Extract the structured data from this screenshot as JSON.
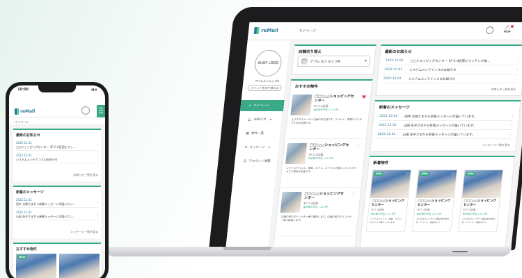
{
  "brand": {
    "app_name": "reMall",
    "accent": "#3aa987",
    "brand_blue": "#2a7a99"
  },
  "laptop": {
    "topbar": {
      "breadcrumb": "マイページ"
    },
    "sidebar": {
      "shop_logo": "SHOP LOGO",
      "shop_name": "アパレルショップA",
      "switch_button": "テナントを切り替える",
      "items": [
        {
          "label": "マイページ",
          "icon": "home-icon",
          "active": true
        },
        {
          "label": "お知らせ",
          "icon": "bell-icon",
          "badge": true
        },
        {
          "label": "物件一覧",
          "icon": "building-icon"
        },
        {
          "label": "メッセージ",
          "icon": "mail-icon",
          "badge": true
        },
        {
          "label": "アカウント情報",
          "icon": "user-icon"
        }
      ]
    },
    "store_switch": {
      "title": "店舗切り替え",
      "selected": "アパレルショップA",
      "thumb": "アパレル"
    },
    "recommended": {
      "title": "おすすめ物件",
      "items": [
        {
          "name": "□□○△△ショッピングセンター",
          "floor": "3F C-4区画",
          "location": "東京都中央区 | 12.5坪",
          "desc": "上りエスカレーター正面の好立地です。アパレル、雑貨などにおすすめの区画です。",
          "favorite": true
        },
        {
          "name": "□□○△△ショッピングセンター",
          "floor": "3F C-4区画",
          "location": "東京都中央区 | 12.5坪",
          "desc": "レディスアパレル、雑貨、カフェ、スフォルで賑わっていてアクセスに便利な区画です。",
          "favorite": false
        },
        {
          "name": "□□○△△ショッピングセンター",
          "floor": "3F C-4区画",
          "location": "東京都中央区 | 12.5坪",
          "desc": "店舗の前のポイントを一番で直接します。店舗の前のポイントを一番で直接します。",
          "favorite": false
        }
      ]
    },
    "news": {
      "title": "最新のお知らせ",
      "rows": [
        {
          "date": "2022.12.01",
          "text": "□□ショッピングセンター 3F C-4区画とマッチング成..."
        },
        {
          "date": "2022.12.01",
          "text": "システムメンテナンスのお知らせ"
        },
        {
          "date": "2022.12.01",
          "text": "システムメンテナンスのお知らせ"
        }
      ],
      "more": "お知らせ一覧を見る"
    },
    "messages": {
      "title": "新着のメッセージ",
      "rows": [
        {
          "date": "2022.12.01",
          "text": "田中 太郎さまから新着メッセージが届いています。"
        },
        {
          "date": "2022.12.01",
          "text": "山田 花子さまから新着メッセージが届いています。"
        },
        {
          "date": "2022.12.01",
          "text": "山田 花子さまから新着メッセージが届いています。"
        }
      ],
      "more": "メッセージ一覧を見る"
    },
    "new_properties": {
      "title": "新着物件",
      "badge": "NEW",
      "cards": [
        {
          "name": "□□○△△ショッピングセンター",
          "floor": "3F C-4区画",
          "location": "東京都中央区 | 12.5坪",
          "desc": "レディスアパレル、雑貨、カフェ、スフォルで賑わっています"
        },
        {
          "name": "□□○△△ショッピングセンター",
          "floor": "3F C-4区画",
          "location": "東京都中央区 | 12.5坪",
          "desc": "上りエスカレーター正面の好立地です。アパレル、雑貨などに"
        },
        {
          "name": "□□○△△ショッピングセンター",
          "floor": "3F C-4区画",
          "location": "東京都中央区 | 12.5坪",
          "desc": "上りエスカレーター正面の好立地です。アパレル、雑貨などに"
        }
      ]
    }
  },
  "phone": {
    "status": {
      "time": "10:00",
      "battery": "▮▮ ▮"
    },
    "breadcrumb": "マイページ",
    "news": {
      "title": "最新のお知らせ",
      "rows": [
        {
          "date": "2022.12.01",
          "text": "□□ショッピングセンター 3F C-4区画とマッ..."
        },
        {
          "date": "2022.12.01",
          "text": "システムメンテナンスのお知らせ"
        }
      ],
      "more": "お知らせ一覧を見る"
    },
    "messages": {
      "title": "新着のメッセージ",
      "rows": [
        {
          "date": "2022.12.01",
          "text": "田中 太郎さまから新着メッセージが届いてい..."
        },
        {
          "date": "2022.12.01",
          "text": "山田 花子さまから新着メッセージが届いてい..."
        }
      ],
      "more": "メッセージ一覧を見る"
    },
    "recommended": {
      "title": "おすすめ物件",
      "badge": "NEW"
    }
  }
}
